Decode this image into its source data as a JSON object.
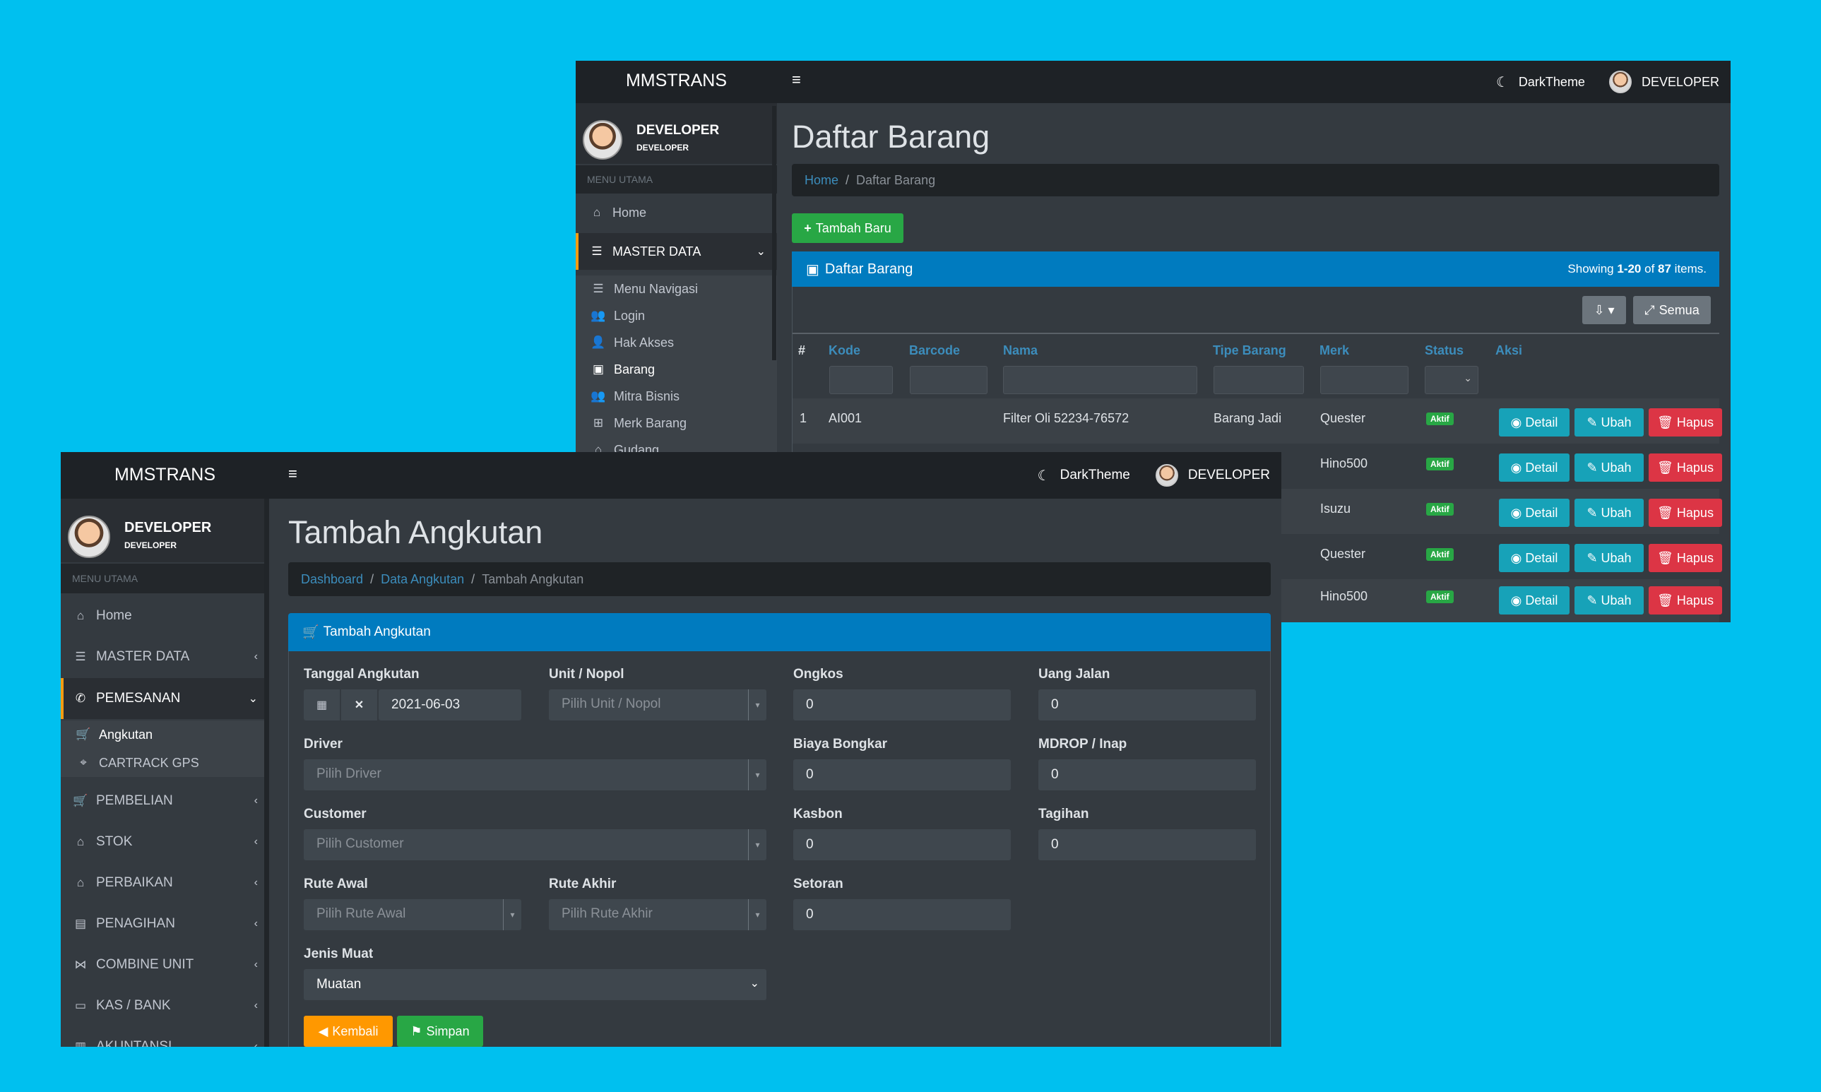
{
  "back": {
    "brand": "MMSTRANS",
    "menu_icon": "≡",
    "theme_label": "DarkTheme",
    "user": "DEVELOPER",
    "sidebar": {
      "user_name": "DEVELOPER",
      "user_role": "DEVELOPER",
      "menu_header": "MENU UTAMA",
      "items": [
        {
          "icon": "home-icon",
          "label": "Home"
        },
        {
          "icon": "database-icon",
          "label": "MASTER DATA"
        }
      ],
      "subitems": [
        {
          "icon": "list-icon",
          "label": "Menu Navigasi"
        },
        {
          "icon": "users-icon",
          "label": "Login"
        },
        {
          "icon": "user-lock-icon",
          "label": "Hak Akses"
        },
        {
          "icon": "box-icon",
          "label": "Barang"
        },
        {
          "icon": "users-icon",
          "label": "Mitra Bisnis"
        },
        {
          "icon": "sitemap-icon",
          "label": "Merk Barang"
        },
        {
          "icon": "warehouse-icon",
          "label": "Gudang"
        }
      ]
    },
    "page_title": "Daftar Barang",
    "breadcrumb": {
      "home": "Home",
      "current": "Daftar Barang"
    },
    "add_button": "Tambah Baru",
    "card_title": "Daftar Barang",
    "summary": {
      "prefix": "Showing ",
      "range": "1-20",
      "mid": " of ",
      "total": "87",
      "suffix": " items."
    },
    "export_icon": "export-icon",
    "all_button": "Semua",
    "columns": [
      "#",
      "Kode",
      "Barcode",
      "Nama",
      "Tipe Barang",
      "Merk",
      "Status",
      "Aksi"
    ],
    "rows": [
      {
        "no": "1",
        "kode": "AI001",
        "barcode": "",
        "nama": "Filter Oli 52234-76572",
        "tipe": "Barang Jadi",
        "merk": "Quester",
        "status": "Aktif"
      },
      {
        "no": "",
        "kode": "",
        "barcode": "",
        "nama": "",
        "tipe": "",
        "merk": "Hino500",
        "status": "Aktif"
      },
      {
        "no": "",
        "kode": "",
        "barcode": "",
        "nama": "",
        "tipe": "",
        "merk": "Isuzu",
        "status": "Aktif"
      },
      {
        "no": "",
        "kode": "",
        "barcode": "",
        "nama": "",
        "tipe": "",
        "merk": "Quester",
        "status": "Aktif"
      },
      {
        "no": "",
        "kode": "",
        "barcode": "",
        "nama": "",
        "tipe": "",
        "merk": "Hino500",
        "status": "Aktif"
      }
    ],
    "actions": {
      "detail": "Detail",
      "ubah": "Ubah",
      "hapus": "Hapus"
    }
  },
  "front": {
    "brand": "MMSTRANS",
    "menu_icon": "≡",
    "theme_label": "DarkTheme",
    "user": "DEVELOPER",
    "sidebar": {
      "user_name": "DEVELOPER",
      "user_role": "DEVELOPER",
      "menu_header": "MENU UTAMA",
      "items": [
        {
          "label": "Home"
        },
        {
          "label": "MASTER DATA"
        },
        {
          "label": "PEMESANAN"
        },
        {
          "label": "Angkutan"
        },
        {
          "label": "CARTRACK GPS"
        },
        {
          "label": "PEMBELIAN"
        },
        {
          "label": "STOK"
        },
        {
          "label": "PERBAIKAN"
        },
        {
          "label": "PENAGIHAN"
        },
        {
          "label": "COMBINE UNIT"
        },
        {
          "label": "KAS / BANK"
        },
        {
          "label": "AKUNTANSI"
        }
      ]
    },
    "page_title": "Tambah Angkutan",
    "breadcrumb": {
      "l1": "Dashboard",
      "l2": "Data Angkutan",
      "current": "Tambah Angkutan"
    },
    "card_title": "Tambah Angkutan",
    "form": {
      "tanggal_label": "Tanggal Angkutan",
      "tanggal_value": "2021-06-03",
      "unit_label": "Unit / Nopol",
      "unit_placeholder": "Pilih Unit / Nopol",
      "ongkos_label": "Ongkos",
      "ongkos_value": "0",
      "uang_jalan_label": "Uang Jalan",
      "uang_jalan_value": "0",
      "driver_label": "Driver",
      "driver_placeholder": "Pilih Driver",
      "biaya_bongkar_label": "Biaya Bongkar",
      "biaya_bongkar_value": "0",
      "mdrop_label": "MDROP / Inap",
      "mdrop_value": "0",
      "customer_label": "Customer",
      "customer_placeholder": "Pilih Customer",
      "kasbon_label": "Kasbon",
      "kasbon_value": "0",
      "tagihan_label": "Tagihan",
      "tagihan_value": "0",
      "rute_awal_label": "Rute Awal",
      "rute_awal_placeholder": "Pilih Rute Awal",
      "rute_akhir_label": "Rute Akhir",
      "rute_akhir_placeholder": "Pilih Rute Akhir",
      "setoran_label": "Setoran",
      "setoran_value": "0",
      "jenis_muat_label": "Jenis Muat",
      "jenis_muat_value": "Muatan"
    },
    "buttons": {
      "kembali": "Kembali",
      "simpan": "Simpan"
    }
  },
  "colors": {
    "background": "#00c0ef",
    "navbar": "#1e2226",
    "panel": "#343a40",
    "primary": "#007bbf",
    "success": "#28a745",
    "info": "#17a2b8",
    "danger": "#dc3545",
    "warning": "#ff9800",
    "link": "#3c8dbc"
  }
}
